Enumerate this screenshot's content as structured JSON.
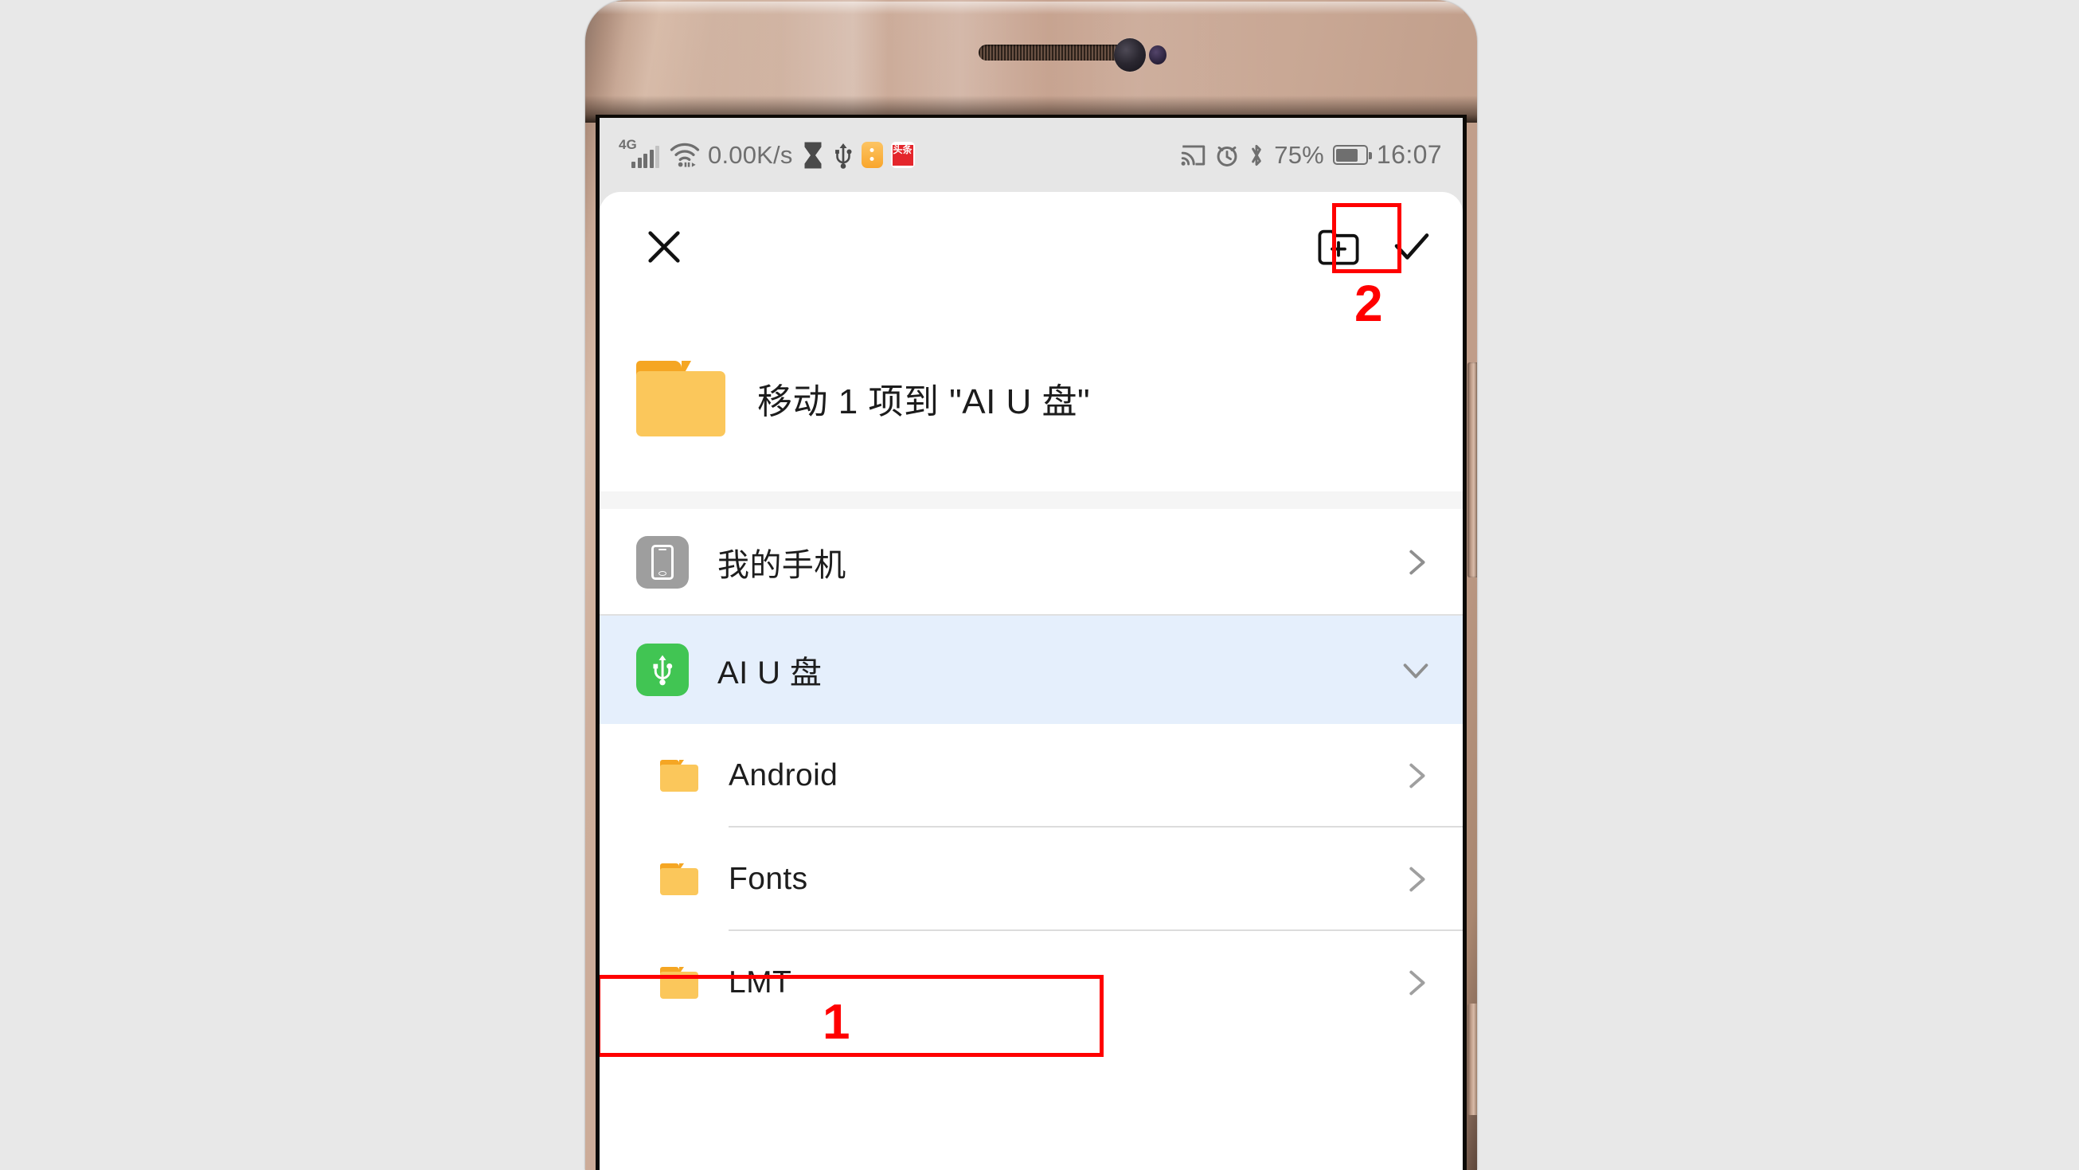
{
  "statusbar": {
    "network_type": "4G",
    "data_rate": "0.00K/s",
    "battery_percent": "75%",
    "time": "16:07",
    "app_badge_red_label": "头条",
    "icons": [
      "signal-icon",
      "wifi-icon",
      "hourglass-icon",
      "usb-icon",
      "app-notification-icon",
      "toutiao-app-icon",
      "cast-icon",
      "alarm-icon",
      "bluetooth-icon",
      "battery-icon"
    ]
  },
  "toolbar": {
    "close_label": "close-icon",
    "new_folder_label": "new-folder-icon",
    "confirm_label": "check-icon"
  },
  "header": {
    "title": "移动 1 项到 \"AI U 盘\"",
    "folder_icon": "folder-icon"
  },
  "list": {
    "items": [
      {
        "label": "我的手机",
        "icon": "phone-icon",
        "chevron": "chevron-right-icon",
        "selected": false
      },
      {
        "label": "AI U 盘",
        "icon": "usb-icon",
        "chevron": "chevron-down-icon",
        "selected": true
      }
    ],
    "children": [
      {
        "label": "Android",
        "icon": "folder-icon",
        "chevron": "chevron-right-icon"
      },
      {
        "label": "Fonts",
        "icon": "folder-icon",
        "chevron": "chevron-right-icon"
      },
      {
        "label": "LMT",
        "icon": "folder-icon",
        "chevron": "chevron-right-icon"
      }
    ]
  },
  "annotations": {
    "step1": "1",
    "step2": "2",
    "color": "#ff0000"
  },
  "colors": {
    "selected_row": "#e5effc",
    "usb_icon": "#41c553",
    "folder": "#fbc75b",
    "folder_tab": "#f5a623",
    "status_bar_bg": "#e6e6e6",
    "page_bg": "#e8e8e8"
  }
}
